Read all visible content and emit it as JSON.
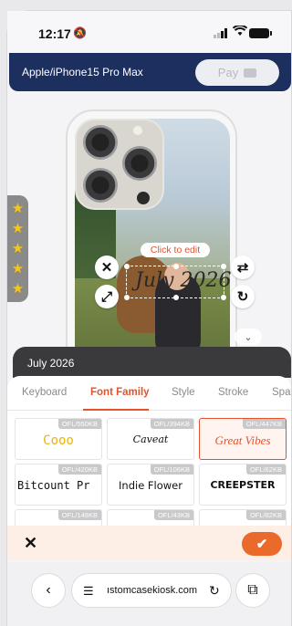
{
  "status_bar": {
    "time": "12:17"
  },
  "header": {
    "model": "Apple/iPhone15 Pro Max",
    "pay_label": "Pay"
  },
  "editor": {
    "click_to_edit": "Click to edit",
    "text_content": "July 2026"
  },
  "rating": {
    "stars": 5
  },
  "text_panel": {
    "current_text": "July 2026",
    "tabs": [
      "Keyboard",
      "Font Family",
      "Style",
      "Stroke",
      "Spa"
    ],
    "active_tab": "Font Family",
    "fonts": [
      {
        "license": "OFL/550KB",
        "sample": "Cooo"
      },
      {
        "license": "OFL/394KB",
        "sample": "Caveat"
      },
      {
        "license": "OFL/447KB",
        "sample": "Great Vibes",
        "selected": true
      },
      {
        "license": "OFL/420KB",
        "sample": "Bitcount Pr"
      },
      {
        "license": "OFL/106KB",
        "sample": "Indie Flower"
      },
      {
        "license": "OFL/62KB",
        "sample": "CREEPSTER"
      },
      {
        "license": "OFL/148KB",
        "sample": ""
      },
      {
        "license": "OFL/43KB",
        "sample": ""
      },
      {
        "license": "OFL/82KB",
        "sample": ""
      }
    ]
  },
  "browser": {
    "url": "ıstomcasekiosk.com"
  },
  "colors": {
    "accent": "#e5512b",
    "header": "#1d2f5e",
    "star": "#f6c517"
  },
  "icons": [
    "mute-bell-icon",
    "signal-icon",
    "wifi-icon",
    "battery-icon",
    "wallet-icon",
    "close-icon",
    "resize-icon",
    "flip-icon",
    "rotate-icon",
    "chevron-down-icon",
    "star-icon",
    "check-icon",
    "back-icon",
    "menu-icon",
    "reload-icon",
    "tabs-icon"
  ]
}
